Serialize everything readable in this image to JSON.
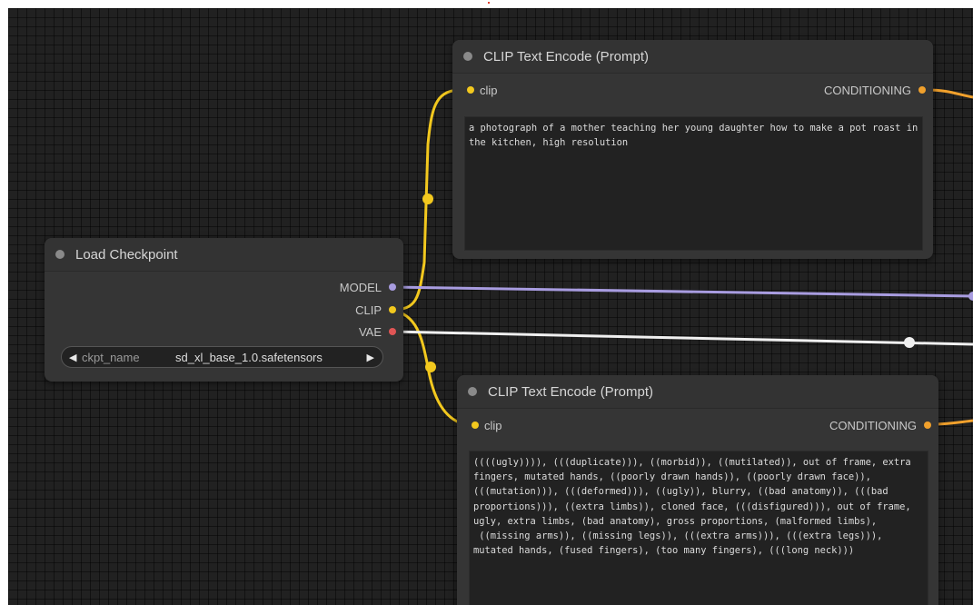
{
  "nodes": {
    "positive_prompt": {
      "title": "CLIP Text Encode (Prompt)",
      "input_label": "clip",
      "output_label": "CONDITIONING",
      "text": "a photograph of a mother teaching her young daughter how to make a pot roast in the kitchen, high resolution"
    },
    "load_checkpoint": {
      "title": "Load Checkpoint",
      "outputs": [
        "MODEL",
        "CLIP",
        "VAE"
      ],
      "widget_name": "ckpt_name",
      "widget_value": "sd_xl_base_1.0.safetensors",
      "arrow_left": "◀",
      "arrow_right": "▶"
    },
    "negative_prompt": {
      "title": "CLIP Text Encode (Prompt)",
      "input_label": "clip",
      "output_label": "CONDITIONING",
      "text": "((((ugly)))), (((duplicate))), ((morbid)), ((mutilated)), out of frame, extra fingers, mutated hands, ((poorly drawn hands)), ((poorly drawn face)), (((mutation))), (((deformed))), ((ugly)), blurry, ((bad anatomy)), (((bad proportions))), ((extra limbs)), cloned face, (((disfigured))), out of frame, ugly, extra limbs, (bad anatomy), gross proportions, (malformed limbs),\n ((missing arms)), ((missing legs)), (((extra arms))), (((extra legs))), mutated hands, (fused fingers), (too many fingers), (((long neck)))"
    }
  },
  "colors": {
    "canvas_bg": "#212121",
    "node_bg": "#353535",
    "clip_wire": "#f2c81e",
    "model_wire": "#a89ce0",
    "vae_wire": "#f0f0f0",
    "conditioning_wire": "#f0a02c",
    "vae_dot": "#e05555"
  }
}
